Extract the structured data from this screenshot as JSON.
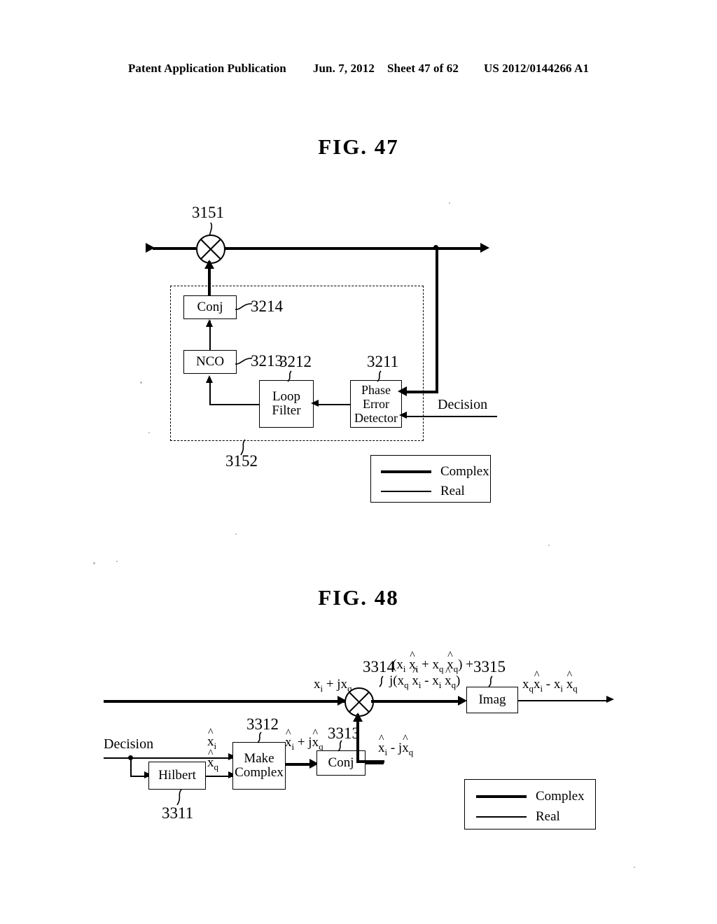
{
  "header": {
    "publication": "Patent Application Publication",
    "date": "Jun. 7, 2012",
    "sheet": "Sheet 47 of 62",
    "patent_number": "US 2012/0144266 A1"
  },
  "fig47": {
    "title": "FIG. 47",
    "blocks": {
      "conj": "Conj",
      "nco": "NCO",
      "loop_filter": "Loop\nFilter",
      "loop_filter_line1": "Loop",
      "loop_filter_line2": "Filter",
      "phase_error_line1": "Phase",
      "phase_error_line2": "Error",
      "phase_error_line3": "Detector"
    },
    "refs": {
      "multiplier": "3151",
      "conj": "3214",
      "nco": "3213",
      "loop_filter": "3212",
      "phase_error_detector": "3211",
      "dashed_group": "3152"
    },
    "labels": {
      "decision": "Decision"
    },
    "legend": {
      "complex": "Complex",
      "real": "Real"
    }
  },
  "fig48": {
    "title": "FIG. 48",
    "blocks": {
      "imag": "Imag",
      "hilbert": "Hilbert",
      "make_complex_line1": "Make",
      "make_complex_line2": "Complex",
      "conj": "Conj"
    },
    "refs": {
      "multiplier": "3314",
      "imag": "3315",
      "hilbert": "3311",
      "make_complex": "3312",
      "conj": "3313"
    },
    "labels": {
      "decision": "Decision",
      "input_signal": "xi + jxq",
      "xi_hat": "x̂i",
      "xq_hat": "x̂q",
      "make_complex_out": "x̂i + jx̂q",
      "conj_out": "x̂i - jx̂q",
      "product_line1": "(xi x̂i + xq x̂q) +",
      "product_line2": "j(xq x̂i - xi x̂q)",
      "output": "xq x̂i - xi x̂q"
    },
    "legend": {
      "complex": "Complex",
      "real": "Real"
    }
  }
}
